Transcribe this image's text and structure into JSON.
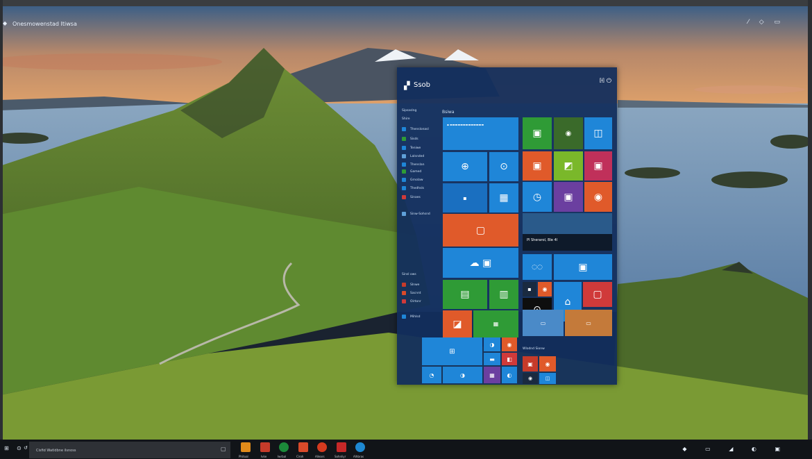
{
  "window": {
    "title": "Onesmowenstad Itiwsa"
  },
  "start": {
    "title": "Ssob",
    "section_label": "Bsiwa",
    "nav": [
      {
        "label": "Sipsaslng"
      },
      {
        "label": "Shire"
      },
      {
        "label": "Thenslonasl"
      },
      {
        "label": "Sisds"
      },
      {
        "label": "Teniwe"
      },
      {
        "label": "Lalsnded"
      },
      {
        "label": "Thenslan"
      },
      {
        "label": "Gamed"
      },
      {
        "label": "Grnolaw"
      },
      {
        "label": "Thedhsls"
      },
      {
        "label": "Sinaes"
      },
      {
        "label": "Sinw-Sohsnd"
      }
    ],
    "nav2_label": "Sinsl ows",
    "nav2": [
      {
        "label": "Slnwe"
      },
      {
        "label": "Sacnnt"
      },
      {
        "label": "Oirtonr"
      },
      {
        "label": "Mihlsd"
      }
    ],
    "news_tile_text": "Pl Sherarol, Ble 4l",
    "group2_label": "Wlodnd Sionw"
  },
  "taskbar": {
    "search_text": "Cisfid Watldbne ilsnoss",
    "apps": [
      {
        "label": "Phitoal",
        "color": "#e08a1a"
      },
      {
        "label": "Ivke",
        "color": "#c63b2a"
      },
      {
        "label": "Iwrbal",
        "color": "#1c8a3a"
      },
      {
        "label": "Ciroh",
        "color": "#d94a2a"
      },
      {
        "label": "Allears",
        "color": "#d43a1f"
      },
      {
        "label": "Sohnliyr",
        "color": "#c62828"
      },
      {
        "label": "Alhbras",
        "color": "#1e88d2"
      }
    ]
  },
  "colors": {
    "start_bg": "#122e5c",
    "tile_blue": "#1f86d8",
    "tile_orange": "#e05a2a",
    "tile_green": "#2f9b36",
    "tile_red": "#d03a3a",
    "tile_purple": "#6b3fa0"
  }
}
